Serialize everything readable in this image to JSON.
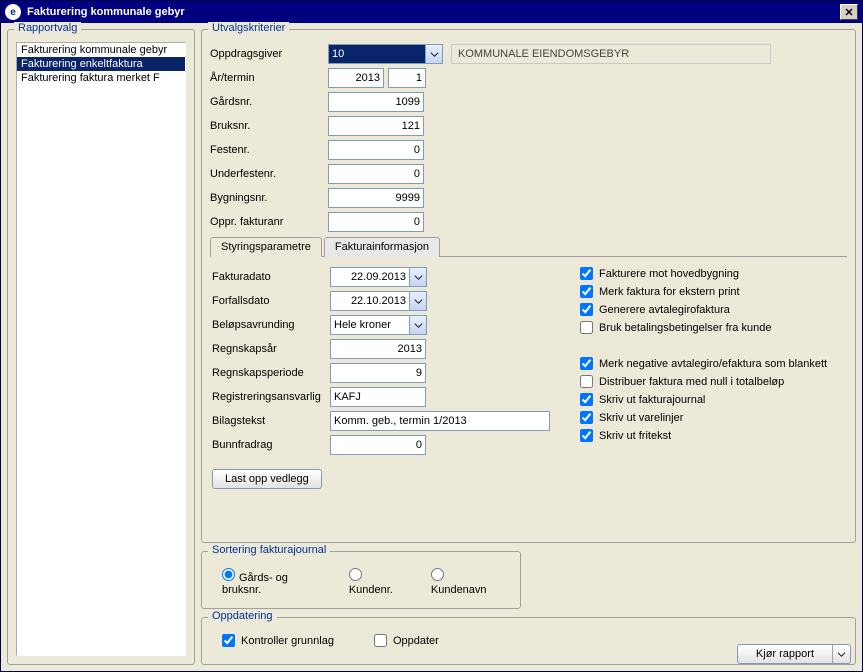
{
  "window": {
    "title": "Fakturering kommunale gebyr"
  },
  "sidebar": {
    "legend": "Rapportvalg",
    "items": [
      {
        "label": "Fakturering kommunale gebyr",
        "selected": false
      },
      {
        "label": "Fakturering enkeltfaktura",
        "selected": true
      },
      {
        "label": "Fakturering faktura merket F",
        "selected": false
      }
    ]
  },
  "criteria": {
    "legend": "Utvalgskriterier",
    "rows": {
      "oppdragsgiver_lbl": "Oppdragsgiver",
      "oppdragsgiver_val": "10",
      "oppdragsgiver_desc": "KOMMUNALE EIENDOMSGEBYR",
      "ar_lbl": "År/termin",
      "ar_val": "2013",
      "termin_val": "1",
      "gard_lbl": "Gårdsnr.",
      "gard_val": "1099",
      "bruk_lbl": "Bruksnr.",
      "bruk_val": "121",
      "feste_lbl": "Festenr.",
      "feste_val": "0",
      "under_lbl": "Underfestenr.",
      "under_val": "0",
      "byg_lbl": "Bygningsnr.",
      "byg_val": "9999",
      "oppr_lbl": "Oppr. fakturanr",
      "oppr_val": "0"
    }
  },
  "tabs": {
    "t1": "Styringsparametre",
    "t2": "Fakturainformasjon"
  },
  "params": {
    "fakturadato_lbl": "Fakturadato",
    "fakturadato_val": "22.09.2013",
    "forfall_lbl": "Forfallsdato",
    "forfall_val": "22.10.2013",
    "belop_lbl": "Beløpsavrunding",
    "belop_val": "Hele kroner",
    "regnar_lbl": "Regnskapsår",
    "regnar_val": "2013",
    "regnper_lbl": "Regnskapsperiode",
    "regnper_val": "9",
    "regansv_lbl": "Registreringsansvarlig",
    "regansv_val": "KAFJ",
    "bilag_lbl": "Bilagstekst",
    "bilag_val": "Komm. geb., termin 1/2013",
    "bunn_lbl": "Bunnfradrag",
    "bunn_val": "0",
    "upload_btn": "Last opp vedlegg"
  },
  "checks": {
    "c1": "Fakturere mot hovedbygning",
    "c2": "Merk faktura for ekstern print",
    "c3": "Generere avtalegirofaktura",
    "c4": "Bruk betalingsbetingelser fra kunde",
    "c5": "Merk negative avtalegiro/efaktura som blankett",
    "c6": "Distribuer faktura med null i totalbeløp",
    "c7": "Skriv ut fakturajournal",
    "c8": "Skriv ut varelinjer",
    "c9": "Skriv ut fritekst"
  },
  "checks_state": {
    "c1": true,
    "c2": true,
    "c3": true,
    "c4": false,
    "c5": true,
    "c6": false,
    "c7": true,
    "c8": true,
    "c9": true
  },
  "sort": {
    "legend": "Sortering fakturajournal",
    "r1": "Gårds- og bruksnr.",
    "r2": "Kundenr.",
    "r3": "Kundenavn"
  },
  "update": {
    "legend": "Oppdatering",
    "c1": "Kontroller grunnlag",
    "c2": "Oppdater"
  },
  "footer": {
    "run": "Kjør rapport"
  }
}
